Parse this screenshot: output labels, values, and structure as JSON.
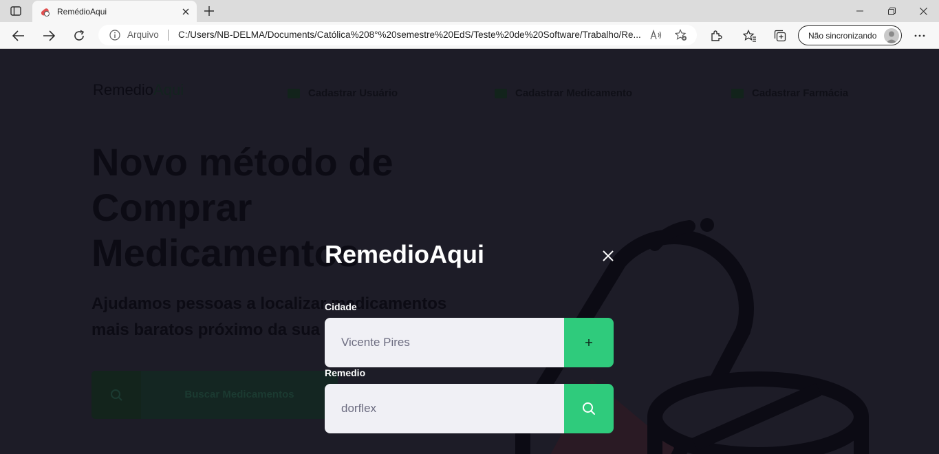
{
  "browser": {
    "tab_title": "RemédioAqui",
    "address_label": "Arquivo",
    "address_url": "C:/Users/NB-DELMA/Documents/Católica%208°%20semestre%20EdS/Teste%20de%20Software/Trabalho/Re...",
    "sync_label": "Não sincronizando"
  },
  "background_page": {
    "logo_main": "Remedio",
    "logo_accent": "Aqui",
    "nav": [
      "Cadastrar Usuário",
      "Cadastrar Medicamento",
      "Cadastrar Farmácia"
    ],
    "hero_lines": [
      "Novo método de",
      "Comprar",
      "Medicamentos"
    ],
    "subtitle": "Ajudamos pessoas a localizar medicamentos mais baratos próximo da sua localização.",
    "cta_label": "Buscar Medicamentos"
  },
  "modal": {
    "title": "RemedioAqui",
    "city_label": "Cidade",
    "city_value": "Vicente Pires",
    "medicine_label": "Remedio",
    "medicine_value": "dorflex",
    "accent_color": "#2fcb7c"
  }
}
